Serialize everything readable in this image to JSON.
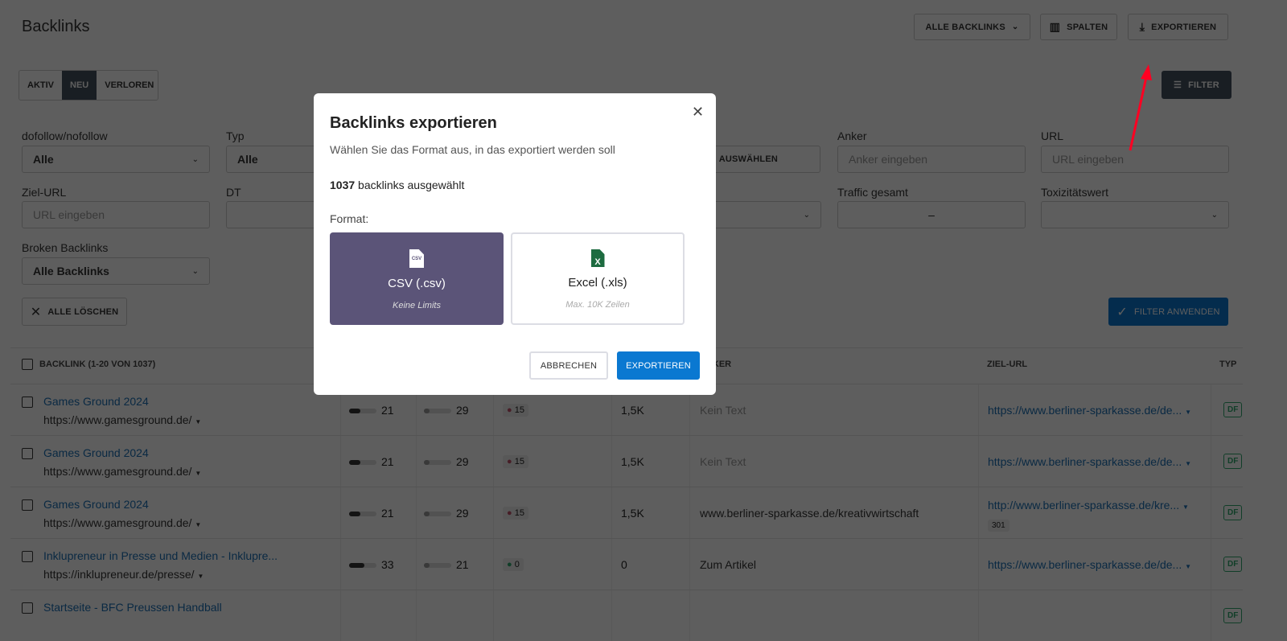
{
  "header": {
    "title": "Backlinks",
    "filter_select": "ALLE BACKLINKS",
    "columns_label": "SPALTEN",
    "export_label": "EXPORTIEREN"
  },
  "status_tabs": [
    {
      "label": "AKTIV",
      "active": false
    },
    {
      "label": "NEU",
      "active": true
    },
    {
      "label": "VERLOREN",
      "active": false
    }
  ],
  "filter_button": "FILTER",
  "filters": {
    "dofollow": {
      "label": "dofollow/nofollow",
      "value": "Alle"
    },
    "typ": {
      "label": "Typ",
      "value": "Alle"
    },
    "range_button": "BEREICH AUSWÄHLEN",
    "anker": {
      "label": "Anker",
      "placeholder": "Anker eingeben"
    },
    "url": {
      "label": "URL",
      "placeholder": "URL eingeben"
    },
    "ziel_url": {
      "label": "Ziel-URL",
      "placeholder": "URL eingeben"
    },
    "dt": {
      "label": "DT"
    },
    "traffic": {
      "label": "Traffic gesamt",
      "separator": "–"
    },
    "toxicity": {
      "label": "Toxizitätswert"
    },
    "broken": {
      "label": "Broken Backlinks",
      "value": "Alle Backlinks"
    },
    "clear_all": "ALLE LÖSCHEN",
    "apply": "FILTER ANWENDEN"
  },
  "table": {
    "headers": {
      "backlink": "BACKLINK (1-20 VON 1037)",
      "anker": "ANKER",
      "ziel_url": "ZIEL-URL",
      "typ": "TYP"
    },
    "rows": [
      {
        "title": "Games Ground 2024",
        "url": "https://www.gamesground.de/",
        "a": "21",
        "a_pct": 40,
        "b": "29",
        "b_pct": 20,
        "tox": "15",
        "tox_color": "#c0506a",
        "traffic": "1,5K",
        "anchor": "Kein Text",
        "anchor_muted": true,
        "target": "https://www.berliner-sparkasse.de/de...",
        "redirect": "",
        "type": "DF"
      },
      {
        "title": "Games Ground 2024",
        "url": "https://www.gamesground.de/",
        "a": "21",
        "a_pct": 40,
        "b": "29",
        "b_pct": 20,
        "tox": "15",
        "tox_color": "#c0506a",
        "traffic": "1,5K",
        "anchor": "Kein Text",
        "anchor_muted": true,
        "target": "https://www.berliner-sparkasse.de/de...",
        "redirect": "",
        "type": "DF"
      },
      {
        "title": "Games Ground 2024",
        "url": "https://www.gamesground.de/",
        "a": "21",
        "a_pct": 40,
        "b": "29",
        "b_pct": 20,
        "tox": "15",
        "tox_color": "#c0506a",
        "traffic": "1,5K",
        "anchor": "www.berliner-sparkasse.de/kreativwirtschaft",
        "anchor_muted": false,
        "target": "http://www.berliner-sparkasse.de/kre...",
        "redirect": "301",
        "type": "DF"
      },
      {
        "title": "Inklupreneur in Presse und Medien - Inklupre...",
        "url": "https://inklupreneur.de/presse/",
        "a": "33",
        "a_pct": 55,
        "b": "21",
        "b_pct": 20,
        "tox": "0",
        "tox_color": "#2ea86b",
        "traffic": "0",
        "anchor": "Zum Artikel",
        "anchor_muted": false,
        "target": "https://www.berliner-sparkasse.de/de...",
        "redirect": "",
        "type": "DF"
      },
      {
        "title": "Startseite - BFC Preussen Handball",
        "type": "DF"
      }
    ]
  },
  "modal": {
    "title": "Backlinks exportieren",
    "subtitle": "Wählen Sie das Format aus, in das exportiert werden soll",
    "count": "1037",
    "count_suffix": "backlinks ausgewählt",
    "format_label": "Format:",
    "options": [
      {
        "icon": "csv-file-icon",
        "icon_text": "CSV",
        "label": "CSV (.csv)",
        "note": "Keine Limits",
        "selected": true
      },
      {
        "icon": "excel-file-icon",
        "icon_text": "X",
        "label": "Excel (.xls)",
        "note": "Max. 10K Zeilen",
        "selected": false
      }
    ],
    "cancel": "ABBRECHEN",
    "confirm": "EXPORTIEREN"
  },
  "colors": {
    "selected_option": "#5b5478",
    "primary": "#0a78d1",
    "annotation_arrow": "#ff0022"
  }
}
